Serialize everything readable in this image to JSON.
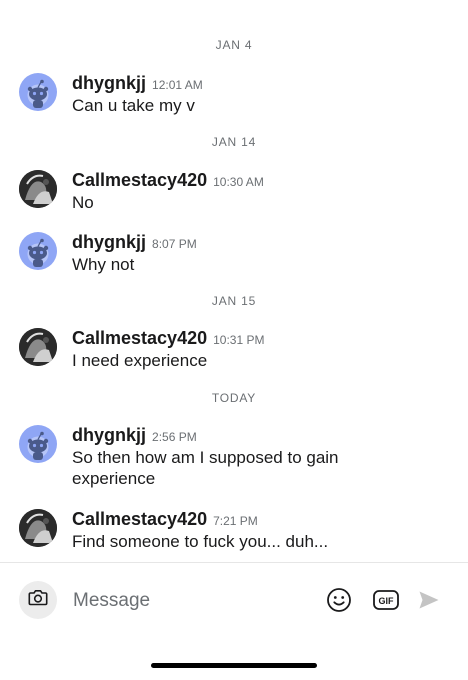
{
  "conversation": {
    "groups": [
      {
        "date": "JAN 4",
        "messages": [
          {
            "user": "dhygnkjj",
            "time": "12:01 AM",
            "text": "Can u take my v",
            "avatar": "snoo-avatar"
          }
        ]
      },
      {
        "date": "JAN 14",
        "messages": [
          {
            "user": "Callmestacy420",
            "time": "10:30 AM",
            "text": "No",
            "avatar": "photo-avatar"
          },
          {
            "user": "dhygnkjj",
            "time": "8:07 PM",
            "text": "Why not",
            "avatar": "snoo-avatar"
          }
        ]
      },
      {
        "date": "JAN 15",
        "messages": [
          {
            "user": "Callmestacy420",
            "time": "10:31 PM",
            "text": "I need experience",
            "avatar": "photo-avatar"
          }
        ]
      },
      {
        "date": "TODAY",
        "messages": [
          {
            "user": "dhygnkjj",
            "time": "2:56 PM",
            "text": "So then how am I supposed to gain experience",
            "avatar": "snoo-avatar"
          },
          {
            "user": "Callmestacy420",
            "time": "7:21 PM",
            "text": "Find someone to fuck you... duh...",
            "avatar": "photo-avatar"
          }
        ]
      }
    ]
  },
  "composer": {
    "placeholder": "Message",
    "icons": [
      "camera-icon",
      "emoji-icon",
      "gif-icon",
      "send-icon"
    ],
    "gif_label": "GIF"
  },
  "colors": {
    "snoo_avatar_bg": "#8fa6f5",
    "text_primary": "#1a1a1b",
    "text_secondary": "#6b6f73",
    "icon_muted": "#c4c4c4"
  }
}
